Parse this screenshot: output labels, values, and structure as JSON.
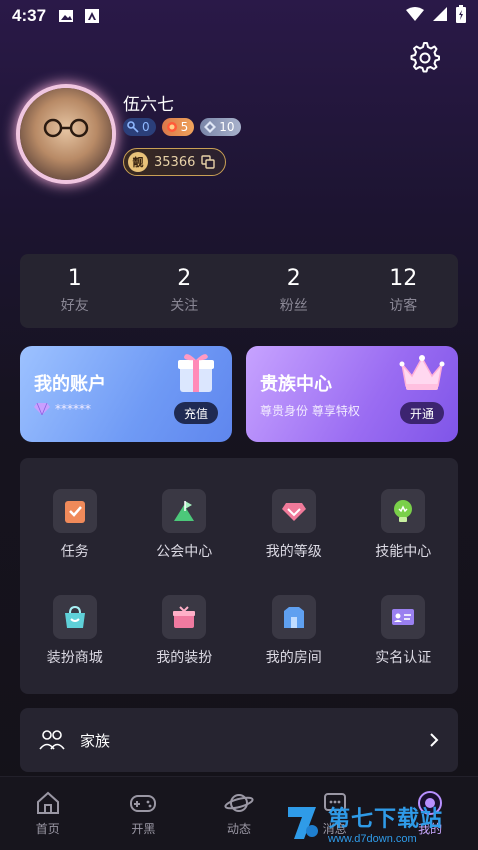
{
  "status_bar": {
    "time": "4:37"
  },
  "profile": {
    "nickname": "伍六七",
    "badges": [
      {
        "icon": "key-icon",
        "value": "0"
      },
      {
        "icon": "heart-level-icon",
        "value": "5"
      },
      {
        "icon": "diamond-level-icon",
        "value": "10"
      }
    ],
    "beauty_id_mark": "靓",
    "beauty_id": "35366"
  },
  "stats": [
    {
      "value": "1",
      "label": "好友"
    },
    {
      "value": "2",
      "label": "关注"
    },
    {
      "value": "2",
      "label": "粉丝"
    },
    {
      "value": "12",
      "label": "访客"
    }
  ],
  "cards": {
    "account": {
      "title": "我的账户",
      "balance_masked": "******",
      "button": "充值"
    },
    "noble": {
      "title": "贵族中心",
      "subtitle": "尊贵身份  尊享特权",
      "button": "开通"
    }
  },
  "grid": [
    {
      "label": "任务",
      "icon": "task-icon",
      "color": "#f08a5a"
    },
    {
      "label": "公会中心",
      "icon": "guild-flag-icon",
      "color": "#4cc87a"
    },
    {
      "label": "我的等级",
      "icon": "level-diamond-icon",
      "color": "#f07a9a"
    },
    {
      "label": "技能中心",
      "icon": "skill-bulb-icon",
      "color": "#7ad04a"
    },
    {
      "label": "装扮商城",
      "icon": "shop-bag-icon",
      "color": "#5fd0d8"
    },
    {
      "label": "我的装扮",
      "icon": "dress-box-icon",
      "color": "#f07aa0"
    },
    {
      "label": "我的房间",
      "icon": "room-icon",
      "color": "#5fa0f0"
    },
    {
      "label": "实名认证",
      "icon": "id-card-icon",
      "color": "#9a80f0"
    }
  ],
  "family": {
    "label": "家族"
  },
  "tabbar": [
    {
      "label": "首页",
      "icon": "home-icon"
    },
    {
      "label": "开黑",
      "icon": "gamepad-icon"
    },
    {
      "label": "动态",
      "icon": "planet-icon"
    },
    {
      "label": "消息",
      "icon": "message-icon"
    },
    {
      "label": "我的",
      "icon": "profile-icon",
      "active": true
    }
  ],
  "watermark": {
    "title": "第七下载站",
    "url": "www.d7down.com"
  }
}
